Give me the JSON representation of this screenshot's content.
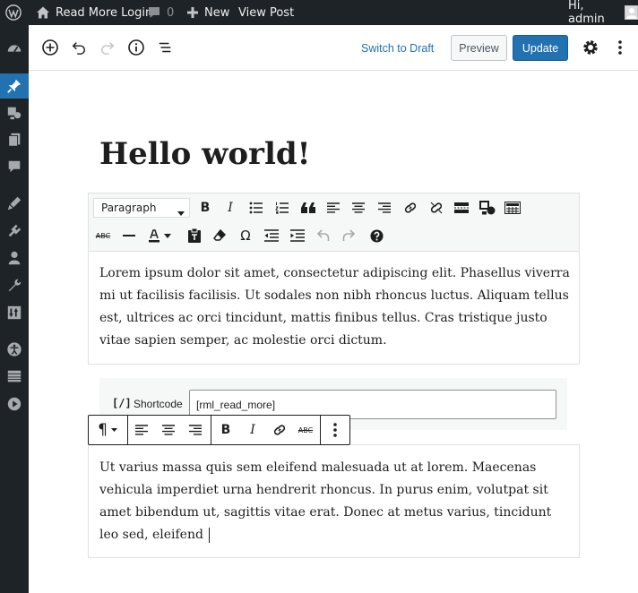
{
  "adminbar": {
    "site_name": "Read More Login",
    "comments_count": "0",
    "new_label": "New",
    "view_post_label": "View Post",
    "greeting": "Hi, admin"
  },
  "toolbar": {
    "switch_to_draft": "Switch to Draft",
    "preview": "Preview",
    "update": "Update"
  },
  "post": {
    "title": "Hello world!",
    "format_select": "Paragraph",
    "paragraph1": "Lorem ipsum dolor sit amet, consectetur adipiscing elit. Phasellus viverra mi ut facilisis facilisis. Ut sodales non nibh rhoncus luctus. Aliquam tellus est, ultrices ac orci tincidunt, mattis finibus tellus. Cras tristique justo vitae sapien semper, ac molestie orci dictum.",
    "shortcode_label": "Shortcode",
    "shortcode_value": "[rml_read_more]",
    "paragraph2": " Ut varius massa quis sem eleifend malesuada ut at lorem. Maecenas vehicula imperdiet urna hendrerit rhoncus. In purus enim, volutpat sit amet bibendum ut, sagittis vitae erat. Donec at metus varius, tincidunt leo sed, eleifend "
  },
  "colors": {
    "admin_bg": "#1d2327",
    "accent": "#2271b1"
  }
}
